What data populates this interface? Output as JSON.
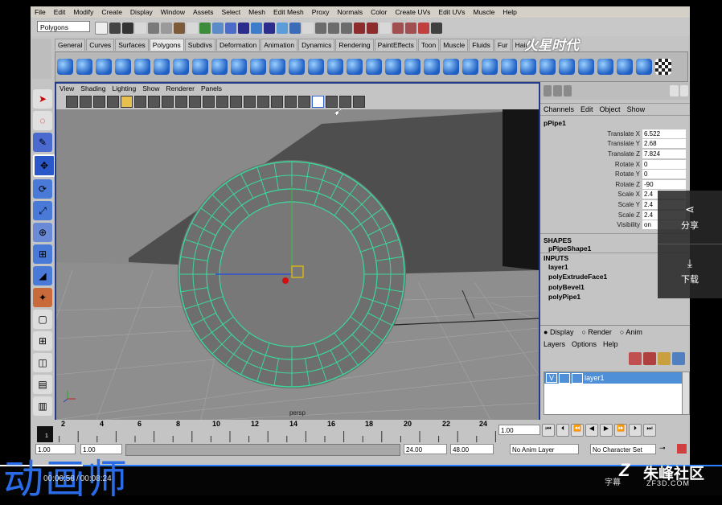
{
  "menubar": {
    "items": [
      "File",
      "Edit",
      "Modify",
      "Create",
      "Display",
      "Window",
      "Assets",
      "Select",
      "Mesh",
      "Edit Mesh",
      "Proxy",
      "Normals",
      "Color",
      "Create UVs",
      "Edit UVs",
      "Muscle",
      "Help"
    ]
  },
  "statusline": {
    "mode": "Polygons"
  },
  "shelf": {
    "tabs": [
      "General",
      "Curves",
      "Surfaces",
      "Polygons",
      "Subdivs",
      "Deformation",
      "Animation",
      "Dynamics",
      "Rendering",
      "PaintEffects",
      "Toon",
      "Muscle",
      "Fluids",
      "Fur",
      "Hair"
    ],
    "active_tab": "Polygons"
  },
  "viewport": {
    "menu": [
      "View",
      "Shading",
      "Lighting",
      "Show",
      "Renderer",
      "Panels"
    ],
    "camera_label": "persp"
  },
  "channel_box": {
    "menu": [
      "Channels",
      "Edit",
      "Object",
      "Show"
    ],
    "object_name": "pPipe1",
    "channels": [
      {
        "label": "Translate X",
        "value": "6.522"
      },
      {
        "label": "Translate Y",
        "value": "2.68"
      },
      {
        "label": "Translate Z",
        "value": "7.824"
      },
      {
        "label": "Rotate X",
        "value": "0"
      },
      {
        "label": "Rotate Y",
        "value": "0"
      },
      {
        "label": "Rotate Z",
        "value": "-90"
      },
      {
        "label": "Scale X",
        "value": "2.4"
      },
      {
        "label": "Scale Y",
        "value": "2.4"
      },
      {
        "label": "Scale Z",
        "value": "2.4"
      },
      {
        "label": "Visibility",
        "value": "on"
      }
    ],
    "shapes_header": "SHAPES",
    "shape_name": "pPipeShape1",
    "inputs_header": "INPUTS",
    "inputs": [
      "layer1",
      "polyExtrudeFace1",
      "polyBevel1",
      "polyPipe1"
    ]
  },
  "layer_editor": {
    "modes": [
      "Display",
      "Render",
      "Anim"
    ],
    "menu": [
      "Layers",
      "Options",
      "Help"
    ],
    "layer_v": "V",
    "layer_name": "layer1"
  },
  "timeline": {
    "ticks": [
      "2",
      "4",
      "6",
      "8",
      "10",
      "12",
      "14",
      "16",
      "18",
      "20",
      "22",
      "24"
    ],
    "current_frame": "1",
    "current_field": "1.00"
  },
  "range": {
    "start": "1.00",
    "start_inner": "1.00",
    "end_inner": "24.00",
    "end": "48.00",
    "anim_layer": "No Anim Layer",
    "character_set": "No Character Set"
  },
  "overlay": {
    "watermark_top": "火星时代",
    "share_label": "分享",
    "download_label": "下载",
    "brand_left": "动画师",
    "time_current": "00:00:58",
    "time_separator": "/",
    "time_total": "00:08:24",
    "subtitle_label": "字幕",
    "site_name": "朱峰社区",
    "site_url": "ZF3D.COM"
  },
  "colors": {
    "selected_blue": "#213b8a",
    "mesh_green": "#3cd79b",
    "layer_highlight": "#4f8fd8"
  }
}
